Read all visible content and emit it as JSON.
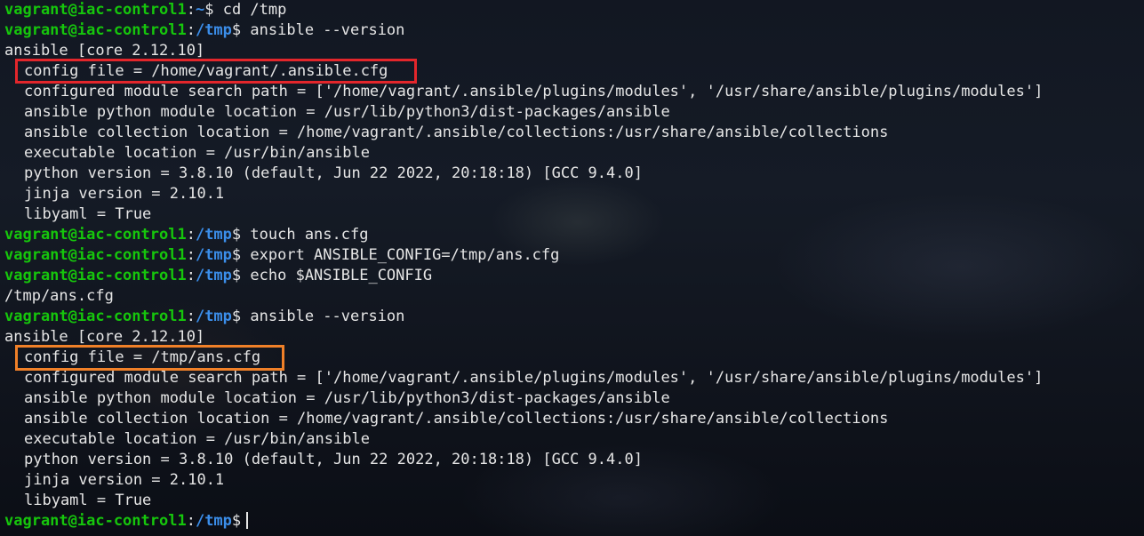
{
  "prompt": {
    "user_host": "vagrant@iac-control1",
    "separator": ":",
    "dir_home": "~",
    "dir_tmp": "/tmp",
    "symbol": "$"
  },
  "commands": {
    "cd": "cd /tmp",
    "version": "ansible --version",
    "touch": "touch ans.cfg",
    "export": "export ANSIBLE_CONFIG=/tmp/ans.cfg",
    "echo": "echo $ANSIBLE_CONFIG"
  },
  "first_output": {
    "header": "ansible [core 2.12.10]",
    "config_file": "config file = /home/vagrant/.ansible.cfg",
    "module_search_path": "configured module search path = ['/home/vagrant/.ansible/plugins/modules', '/usr/share/ansible/plugins/modules']",
    "python_module_location": "ansible python module location = /usr/lib/python3/dist-packages/ansible",
    "collection_location": "ansible collection location = /home/vagrant/.ansible/collections:/usr/share/ansible/collections",
    "executable_location": "executable location = /usr/bin/ansible",
    "python_version": "python version = 3.8.10 (default, Jun 22 2022, 20:18:18) [GCC 9.4.0]",
    "jinja_version": "jinja version = 2.10.1",
    "libyaml": "libyaml = True"
  },
  "echo_output": "/tmp/ans.cfg",
  "second_output": {
    "header": "ansible [core 2.12.10]",
    "config_file": "config file = /tmp/ans.cfg",
    "module_search_path": "configured module search path = ['/home/vagrant/.ansible/plugins/modules', '/usr/share/ansible/plugins/modules']",
    "python_module_location": "ansible python module location = /usr/lib/python3/dist-packages/ansible",
    "collection_location": "ansible collection location = /home/vagrant/.ansible/collections:/usr/share/ansible/collections",
    "executable_location": "executable location = /usr/bin/ansible",
    "python_version": "python version = 3.8.10 (default, Jun 22 2022, 20:18:18) [GCC 9.4.0]",
    "jinja_version": "jinja version = 2.10.1",
    "libyaml": "libyaml = True"
  },
  "colors": {
    "prompt_user": "#16c60c",
    "prompt_path": "#3b8eea",
    "text": "#e6e6e6",
    "highlight_first": "#e3262b",
    "highlight_second": "#f08028"
  }
}
